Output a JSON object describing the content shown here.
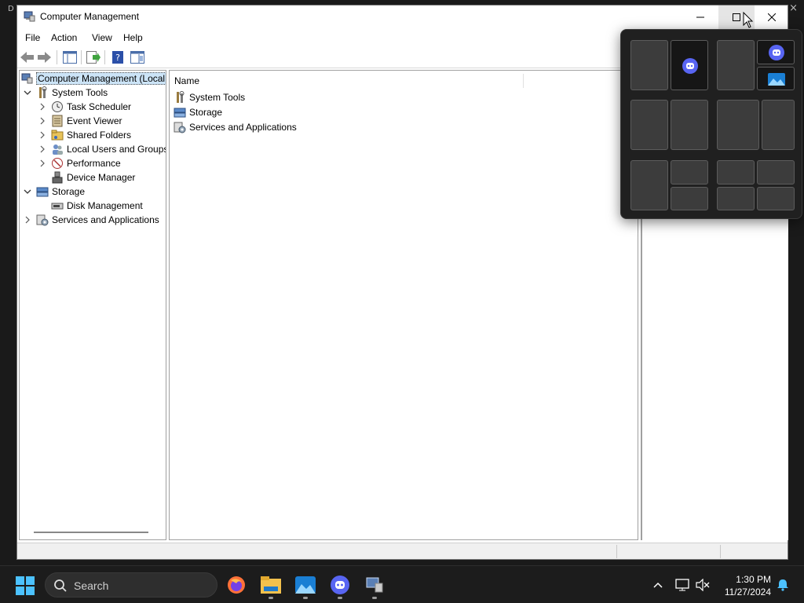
{
  "window": {
    "title": "Computer Management"
  },
  "background": {
    "top_left_glyph": "D",
    "top_right_glyph": "×"
  },
  "menu": {
    "file": "File",
    "action": "Action",
    "view": "View",
    "help": "Help"
  },
  "tree": {
    "root": "Computer Management (Local",
    "system_tools": "System Tools",
    "task_scheduler": "Task Scheduler",
    "event_viewer": "Event Viewer",
    "shared_folders": "Shared Folders",
    "local_users": "Local Users and Groups",
    "performance": "Performance",
    "device_manager": "Device Manager",
    "storage": "Storage",
    "disk_management": "Disk Management",
    "services": "Services and Applications"
  },
  "list": {
    "column_name": "Name",
    "rows": [
      "System Tools",
      "Storage",
      "Services and Applications"
    ]
  },
  "snap_layout": {
    "icons": [
      "discord-icon",
      "discord-icon",
      "photos-icon"
    ]
  },
  "taskbar": {
    "search_label": "Search",
    "time": "1:30 PM",
    "date": "11/27/2024",
    "apps": [
      "firefox-icon",
      "file-explorer-icon",
      "photos-icon",
      "discord-icon",
      "computer-management-icon"
    ]
  },
  "colors": {
    "discord": "#5865f2",
    "windows_blue": "#4cc2ff",
    "selection": "#cce4f7"
  }
}
